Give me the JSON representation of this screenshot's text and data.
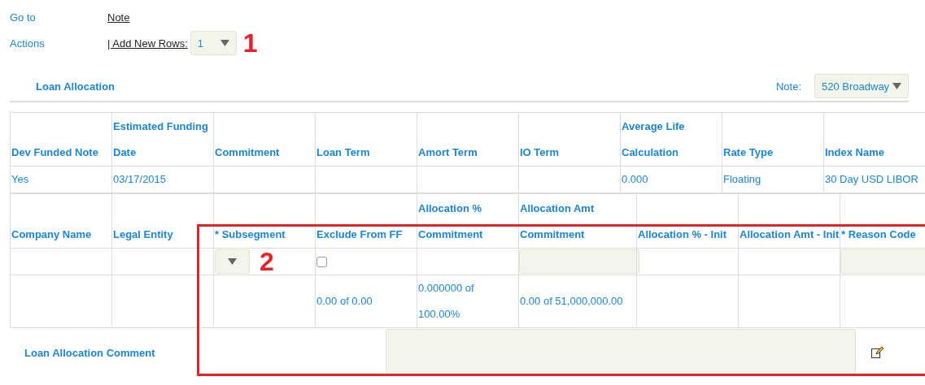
{
  "goto": {
    "label": "Go to",
    "link": "Note"
  },
  "actions": {
    "label": "Actions",
    "link": "| Add New Rows:",
    "select_value": "1",
    "annotation": "1"
  },
  "section": {
    "title": "Loan Allocation",
    "note_label": "Note:",
    "note_value": "520 Broadway"
  },
  "table1": {
    "columns": [
      "Dev Funded Note",
      "Estimated Funding\nDate",
      "Commitment",
      "Loan Term",
      "Amort Term",
      "IO Term",
      "Average Life\nCalculation",
      "Rate Type",
      "Index Name"
    ],
    "rows": [
      [
        "Yes",
        "03/17/2015",
        "",
        "",
        "",
        "",
        "0.000",
        "Floating",
        "30 Day USD LIBOR"
      ]
    ]
  },
  "table2": {
    "columns": [
      "Company Name",
      "Legal Entity",
      "* Subsegment",
      "Exclude From FF",
      "Allocation %\nCommitment",
      "Allocation Amt\nCommitment",
      "Allocation % - Init",
      "Allocation Amt - Init",
      "* Reason Code"
    ],
    "input_row": [
      {
        "kind": "empty"
      },
      {
        "kind": "empty"
      },
      {
        "kind": "select",
        "annotation": "2"
      },
      {
        "kind": "checkbox",
        "checked": false
      },
      {
        "kind": "empty"
      },
      {
        "kind": "input"
      },
      {
        "kind": "empty"
      },
      {
        "kind": "empty"
      },
      {
        "kind": "input"
      }
    ],
    "value_row": [
      {
        "kind": "empty"
      },
      {
        "kind": "empty"
      },
      {
        "kind": "empty"
      },
      {
        "kind": "text",
        "text": "0.00 of 0.00"
      },
      {
        "kind": "text",
        "text": "0.000000 of\n100.00%"
      },
      {
        "kind": "text",
        "text": "0.00 of 51,000,000.00"
      },
      {
        "kind": "empty"
      },
      {
        "kind": "empty"
      },
      {
        "kind": "empty"
      }
    ]
  },
  "comment": {
    "label": "Loan Allocation Comment"
  },
  "highlight_frame": true
}
